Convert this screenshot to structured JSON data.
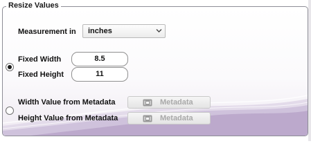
{
  "group": {
    "title": "Resize Values"
  },
  "measurement": {
    "label": "Measurement in",
    "selected": "inches"
  },
  "fixed": {
    "selected": true,
    "width_label": "Fixed Width",
    "width_value": "8.5",
    "height_label": "Fixed Height",
    "height_value": "11"
  },
  "metadata": {
    "selected": false,
    "width_label": "Width Value from Metadata",
    "height_label": "Height Value from Metadata",
    "button_label": "Metadata",
    "button_icon": "metadata-tag-icon"
  },
  "colors": {
    "accent_wave": "#b9a6cb",
    "disabled_text": "#a9a9a9"
  }
}
